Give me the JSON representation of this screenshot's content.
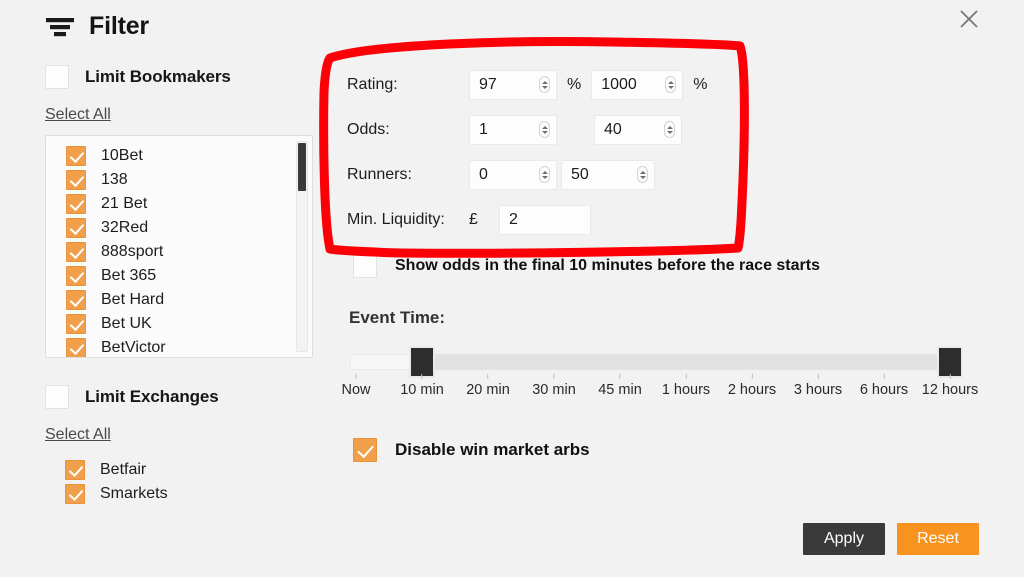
{
  "window": {
    "close_icon": "close-icon"
  },
  "header": {
    "icon": "filter-icon",
    "title": "Filter"
  },
  "bookmakers": {
    "toggle_label": "Limit Bookmakers",
    "toggle_checked": false,
    "select_all": "Select All",
    "items": [
      {
        "label": "10Bet",
        "checked": true
      },
      {
        "label": "138",
        "checked": true
      },
      {
        "label": "21 Bet",
        "checked": true
      },
      {
        "label": "32Red",
        "checked": true
      },
      {
        "label": "888sport",
        "checked": true
      },
      {
        "label": "Bet 365",
        "checked": true
      },
      {
        "label": "Bet Hard",
        "checked": true
      },
      {
        "label": "Bet UK",
        "checked": true
      },
      {
        "label": "BetVictor",
        "checked": true
      }
    ]
  },
  "exchanges": {
    "toggle_label": "Limit Exchanges",
    "toggle_checked": false,
    "select_all": "Select All",
    "items": [
      {
        "label": "Betfair",
        "checked": true
      },
      {
        "label": "Smarkets",
        "checked": true
      }
    ]
  },
  "filters": {
    "rating": {
      "label": "Rating:",
      "min": "97",
      "min_unit": "%",
      "max": "1000",
      "max_unit": "%"
    },
    "odds": {
      "label": "Odds:",
      "min": "1",
      "max": "40"
    },
    "runners": {
      "label": "Runners:",
      "min": "0",
      "max": "50"
    },
    "min_liquidity": {
      "label": "Min. Liquidity:",
      "currency": "£",
      "value": "2"
    }
  },
  "final_minutes": {
    "label": "Show odds in the final 10 minutes before the race starts",
    "checked": false
  },
  "event_time": {
    "title": "Event Time:",
    "ticks": [
      "Now",
      "10 min",
      "20 min",
      "30 min",
      "45 min",
      "1 hours",
      "2 hours",
      "3 hours",
      "6 hours",
      "12 hours"
    ],
    "handle_low_index": 1,
    "handle_high_index": 9
  },
  "win_market": {
    "label": "Disable win market arbs",
    "checked": true
  },
  "footer": {
    "apply_label": "Apply",
    "reset_label": "Reset"
  },
  "annotation": {
    "shape": "red-rectangle-highlight",
    "color": "#fb0007"
  },
  "colors": {
    "accent_orange": "#f0a04b",
    "reset_orange": "#f7931e",
    "apply_dark": "#3a3a3a",
    "annotation_red": "#fb0007",
    "page_bg": "#f2f2f2"
  }
}
